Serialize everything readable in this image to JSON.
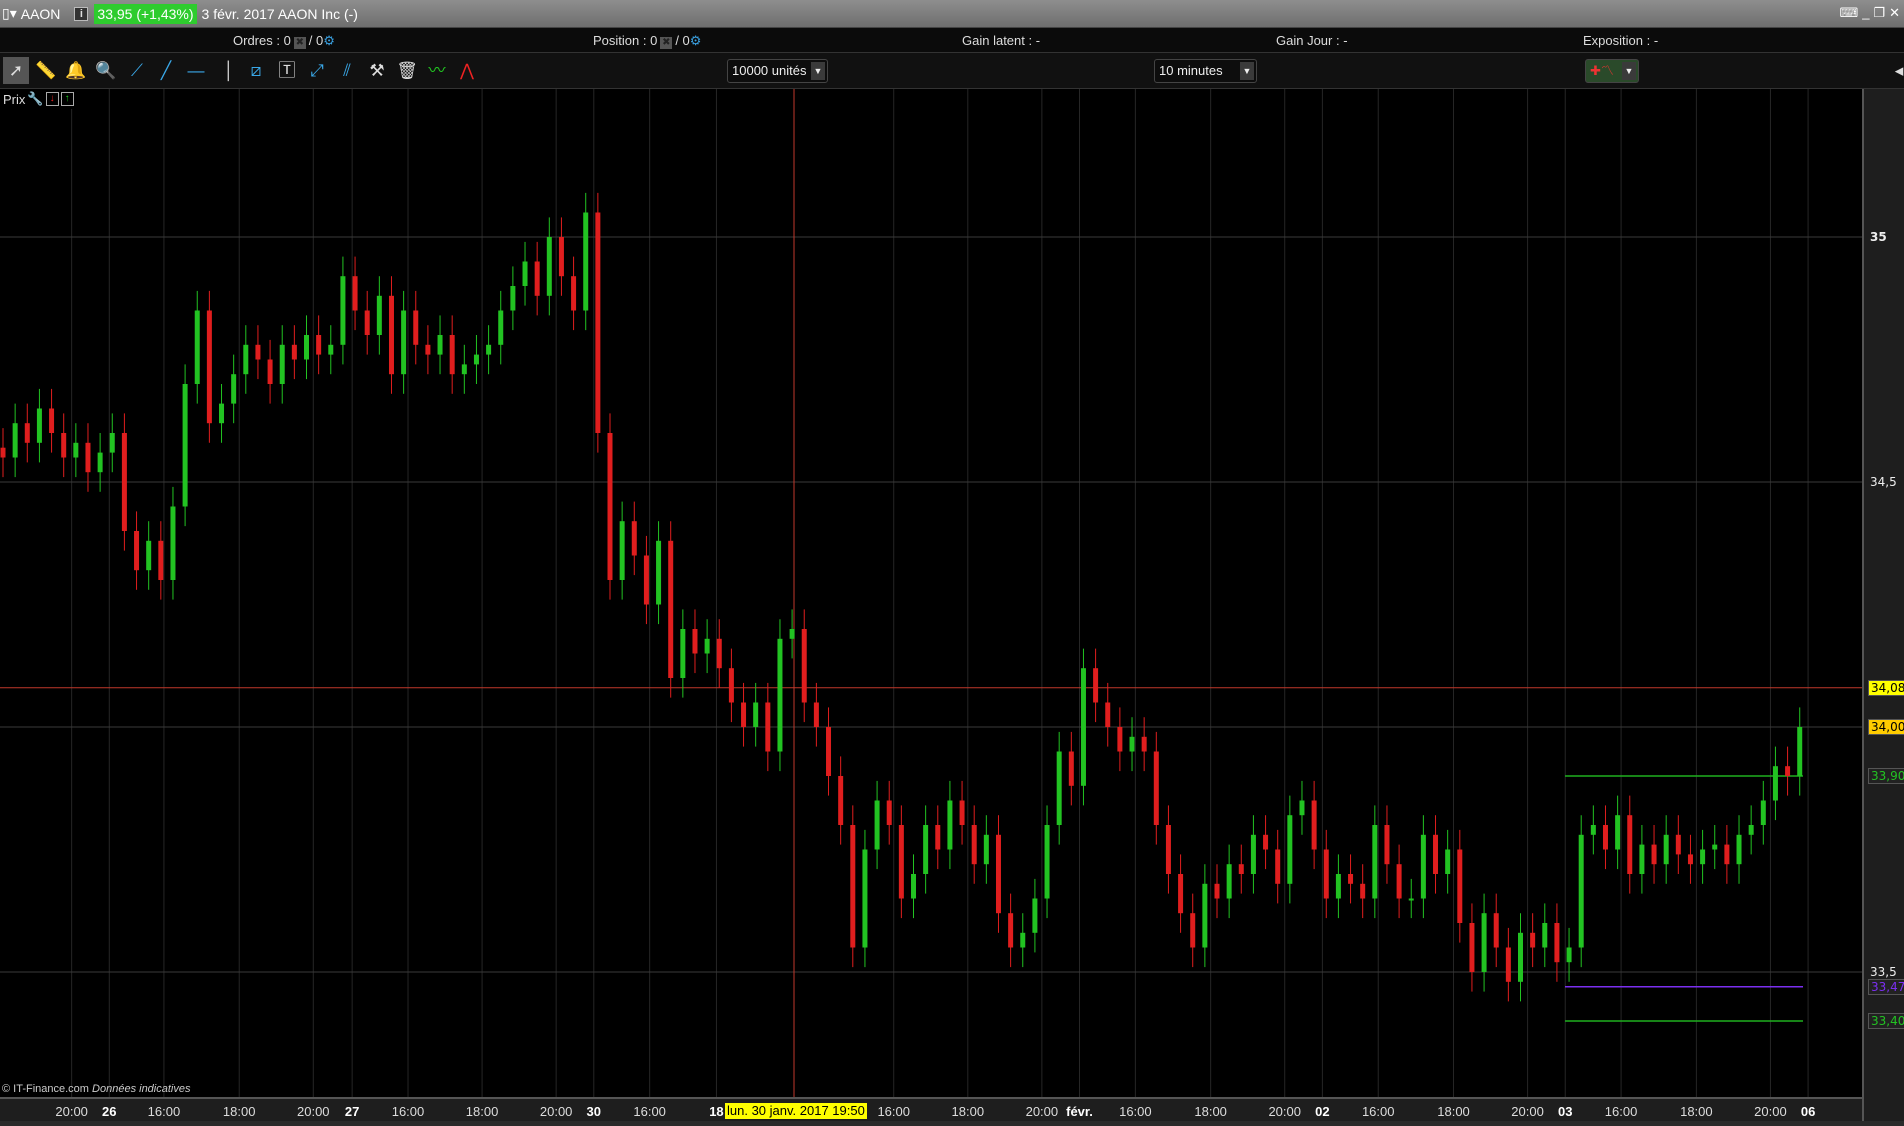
{
  "titlebar": {
    "symbol": "AAON",
    "quote": "33,95 (+1,43%)",
    "desc": "3 févr. 2017 AAON Inc (-)",
    "info": "i"
  },
  "infobar": {
    "ordres": "Ordres : 0",
    "ordres2": "/ 0",
    "position": "Position : 0",
    "position2": "/ 0",
    "gain_latent": "Gain latent : -",
    "gain_jour": "Gain Jour : -",
    "exposition": "Exposition : -"
  },
  "toolbar": {
    "quantity": "10000 unités",
    "interval": "10 minutes"
  },
  "panel": {
    "label": "Prix"
  },
  "footer": {
    "copyright": "© IT-Finance.com",
    "disclaimer": "Données indicatives"
  },
  "crosshair": {
    "tooltip": "lun. 30 janv. 2017 19:50",
    "price": 34.08
  },
  "colors": {
    "up": "#22c322",
    "down": "#e01e1e",
    "crosshair": "#c0392b",
    "level_green": "#1fb01f",
    "level_purple": "#7b2ff0",
    "quote_bg": "#2ecc2e"
  },
  "price_axis": {
    "labels": [
      "35",
      "34,5",
      "33,5"
    ],
    "values": [
      35,
      34.5,
      33.5
    ]
  },
  "markers": [
    {
      "text": "34,08",
      "value": 34.08,
      "bg": "#ffff00",
      "fg": "#000"
    },
    {
      "text": "34,00",
      "value": 34.0,
      "bg": "#ffcc00",
      "fg": "#000"
    },
    {
      "text": "33,900",
      "value": 33.9,
      "bg": "#222",
      "fg": "#22c322"
    },
    {
      "text": "33,470",
      "value": 33.47,
      "bg": "#222",
      "fg": "#7b2ff0"
    },
    {
      "text": "33,400",
      "value": 33.4,
      "bg": "#222",
      "fg": "#22c322"
    }
  ],
  "time_axis": [
    "20:00",
    "26",
    "16:00",
    "18:00",
    "20:00",
    "27",
    "16:00",
    "18:00",
    "20:00",
    "30",
    "16:00",
    "18",
    "16:00",
    "18:00",
    "20:00",
    "févr.",
    "16:00",
    "18:00",
    "20:00",
    "02",
    "16:00",
    "18:00",
    "20:00",
    "03",
    "16:00",
    "18:00",
    "20:00",
    "06"
  ],
  "chart_data": {
    "type": "candlestick",
    "interval": "10 minutes",
    "closes": [
      34.55,
      34.62,
      34.58,
      34.65,
      34.6,
      34.55,
      34.58,
      34.52,
      34.56,
      34.6,
      34.4,
      34.32,
      34.38,
      34.3,
      34.45,
      34.7,
      34.85,
      34.62,
      34.66,
      34.72,
      34.78,
      34.75,
      34.7,
      34.78,
      34.75,
      34.8,
      34.76,
      34.78,
      34.92,
      34.85,
      34.8,
      34.88,
      34.72,
      34.85,
      34.78,
      34.76,
      34.8,
      34.72,
      34.74,
      34.76,
      34.78,
      34.85,
      34.9,
      34.95,
      34.88,
      35.0,
      34.92,
      34.85,
      35.05,
      34.6,
      34.3,
      34.42,
      34.35,
      34.25,
      34.38,
      34.1,
      34.2,
      34.15,
      34.18,
      34.12,
      34.05,
      34.0,
      34.05,
      33.95,
      34.18,
      34.2,
      34.05,
      34.0,
      33.9,
      33.8,
      33.55,
      33.75,
      33.85,
      33.8,
      33.65,
      33.7,
      33.8,
      33.75,
      33.85,
      33.8,
      33.72,
      33.78,
      33.62,
      33.55,
      33.58,
      33.65,
      33.8,
      33.95,
      33.88,
      34.12,
      34.05,
      34.0,
      33.95,
      33.98,
      33.95,
      33.8,
      33.7,
      33.62,
      33.55,
      33.68,
      33.65,
      33.72,
      33.7,
      33.78,
      33.75,
      33.68,
      33.82,
      33.85,
      33.75,
      33.65,
      33.7,
      33.68,
      33.65,
      33.8,
      33.72,
      33.65,
      33.65,
      33.78,
      33.7,
      33.75,
      33.6,
      33.5,
      33.62,
      33.55,
      33.48,
      33.58,
      33.55,
      33.6,
      33.52,
      33.55,
      33.78,
      33.8,
      33.75,
      33.82,
      33.7,
      33.76,
      33.72,
      33.78,
      33.74,
      33.72,
      33.75,
      33.76,
      33.72,
      33.78,
      33.8,
      33.85,
      33.92,
      33.9,
      34.0
    ]
  }
}
